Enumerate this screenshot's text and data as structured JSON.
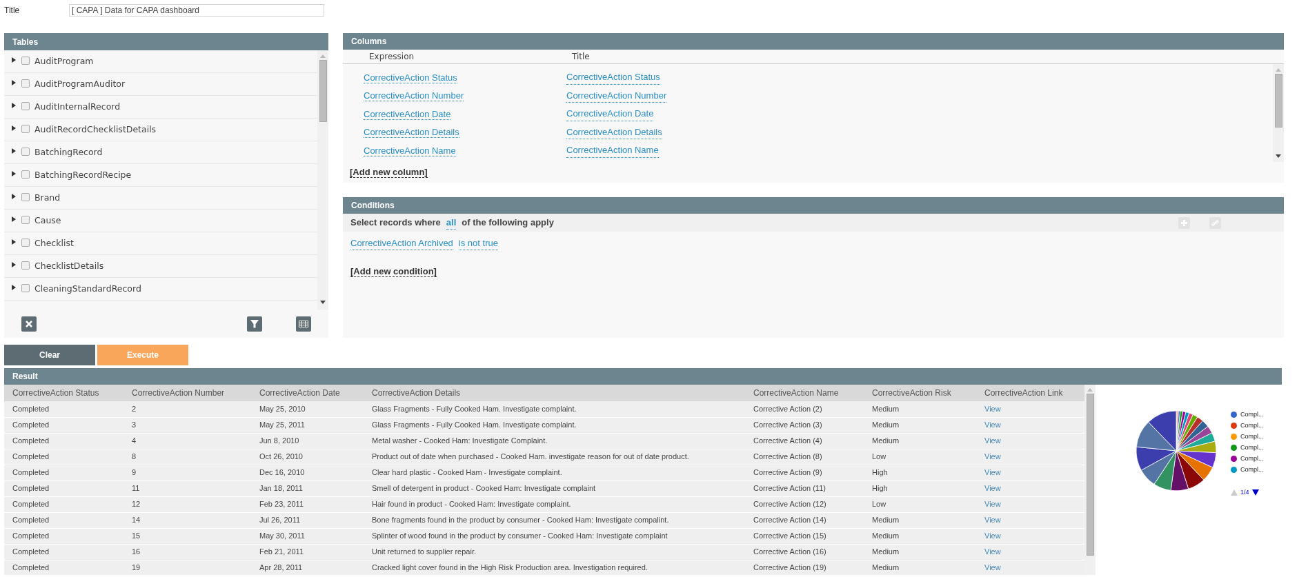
{
  "title_field": {
    "label": "Title",
    "value": "[ CAPA ] Data for CAPA dashboard"
  },
  "tables": {
    "title": "Tables",
    "items": [
      {
        "name": "AuditProgram",
        "expanded": false,
        "checked": false
      },
      {
        "name": "AuditProgramAuditor",
        "expanded": false,
        "checked": false
      },
      {
        "name": "AuditInternalRecord",
        "expanded": false,
        "checked": false
      },
      {
        "name": "AuditRecordChecklistDetails",
        "expanded": false,
        "checked": false
      },
      {
        "name": "BatchingRecord",
        "expanded": false,
        "checked": false
      },
      {
        "name": "BatchingRecordRecipe",
        "expanded": false,
        "checked": false
      },
      {
        "name": "Brand",
        "expanded": false,
        "checked": false
      },
      {
        "name": "Cause",
        "expanded": false,
        "checked": false
      },
      {
        "name": "Checklist",
        "expanded": false,
        "checked": false
      },
      {
        "name": "ChecklistDetails",
        "expanded": false,
        "checked": false
      },
      {
        "name": "CleaningStandardRecord",
        "expanded": false,
        "checked": false
      }
    ]
  },
  "columns": {
    "title": "Columns",
    "headers": [
      "Expression",
      "Title"
    ],
    "rows": [
      {
        "expression": "CorrectiveAction Status",
        "title": "CorrectiveAction Status"
      },
      {
        "expression": "CorrectiveAction Number",
        "title": "CorrectiveAction Number"
      },
      {
        "expression": "CorrectiveAction Date",
        "title": "CorrectiveAction Date"
      },
      {
        "expression": "CorrectiveAction Details",
        "title": "CorrectiveAction Details"
      },
      {
        "expression": "CorrectiveAction Name",
        "title": "CorrectiveAction Name"
      }
    ],
    "add_link": "[Add new column]"
  },
  "conditions": {
    "title": "Conditions",
    "prefix": "Select records where",
    "quantifier": "all",
    "suffix": "of the following apply",
    "items": [
      {
        "field": "CorrectiveAction Archived",
        "operator": "is not true"
      }
    ],
    "add_link": "[Add new condition]"
  },
  "buttons": [
    {
      "label": "Clear",
      "kind": "dark"
    },
    {
      "label": "Execute",
      "kind": "accent"
    }
  ],
  "result": {
    "title": "Result",
    "columns": [
      "CorrectiveAction Status",
      "CorrectiveAction Number",
      "CorrectiveAction Date",
      "CorrectiveAction Details",
      "CorrectiveAction Name",
      "CorrectiveAction Risk",
      "CorrectiveAction Link"
    ],
    "rows": [
      [
        "Completed",
        "2",
        "May 25, 2010",
        "Glass Fragments - Fully Cooked Ham. Investigate complaint.",
        "Corrective Action (2)",
        "Medium",
        "View"
      ],
      [
        "Completed",
        "3",
        "May 25, 2011",
        "Glass Fragments - Fully Cooked Ham. Investigate complaint.",
        "Corrective Action (3)",
        "Medium",
        "View"
      ],
      [
        "Completed",
        "4",
        "Jun 8, 2010",
        "Metal washer - Cooked Ham: Investigate Complaint.",
        "Corrective Action (4)",
        "Medium",
        "View"
      ],
      [
        "Completed",
        "8",
        "Oct 26, 2010",
        "Product out of date when purchased - Cooked Ham. investigate reason for out of date product.",
        "Corrective Action (8)",
        "Low",
        "View"
      ],
      [
        "Completed",
        "9",
        "Dec 16, 2010",
        "Clear hard plastic - Cooked Ham - Investigate complaint.",
        "Corrective Action (9)",
        "High",
        "View"
      ],
      [
        "Completed",
        "11",
        "Jan 18, 2011",
        "Smell of detergent in product - Cooked Ham: Investigate complaint",
        "Corrective Action (11)",
        "High",
        "View"
      ],
      [
        "Completed",
        "12",
        "Feb 23, 2011",
        "Hair found in product - Cooked Ham: Investigate complaint.",
        "Corrective Action (12)",
        "Low",
        "View"
      ],
      [
        "Completed",
        "14",
        "Jul 26, 2011",
        "Bone fragments found in the product by consumer - Cooked Ham: Investigate compalint.",
        "Corrective Action (14)",
        "Medium",
        "View"
      ],
      [
        "Completed",
        "15",
        "May 30, 2011",
        "Splinter of wood found in the product by consumer - Cooked Ham: Investigate complaint",
        "Corrective Action (15)",
        "Medium",
        "View"
      ],
      [
        "Completed",
        "16",
        "Feb 21, 2011",
        "Unit returned to supplier repair.",
        "Corrective Action (16)",
        "Medium",
        "View"
      ],
      [
        "Completed",
        "19",
        "Apr 28, 2011",
        "Cracked light cover found in the High Risk Production area. Investigation required.",
        "Corrective Action (19)",
        "Medium",
        "View"
      ]
    ]
  },
  "chart_legend": {
    "items": [
      {
        "label": "Compl...",
        "color": "#3366cc"
      },
      {
        "label": "Compl...",
        "color": "#dc3912"
      },
      {
        "label": "Compl...",
        "color": "#ff9900"
      },
      {
        "label": "Compl...",
        "color": "#109618"
      },
      {
        "label": "Compl...",
        "color": "#990099"
      },
      {
        "label": "Compl...",
        "color": "#0099c6"
      }
    ],
    "page": "1/4"
  }
}
